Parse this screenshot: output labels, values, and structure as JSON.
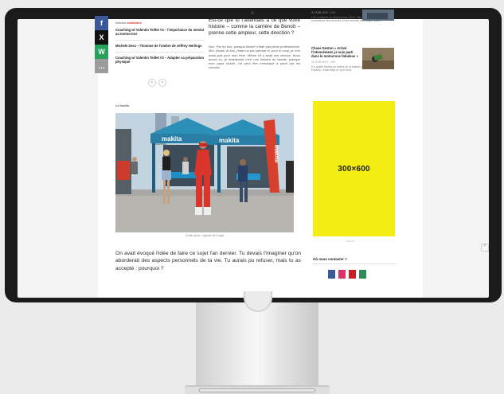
{
  "share": {
    "facebook": "f",
    "x": "X",
    "whatsapp": "W",
    "more": "…"
  },
  "related": {
    "heading_prefix": "Articles",
    "heading_accent": "similaires",
    "items": [
      "Coaching w/ Valentin Teillet #4 – l'importance du mental au motocross",
      "Michele Dera – l'homme de l'ombre de Jeffrey Herlings",
      "Coaching w/ Valentin Teillet #3 – Adapter sa préparation physique"
    ],
    "pager_prev": "‹",
    "pager_next": "›"
  },
  "article": {
    "intro_question": "Est-ce que tu t'attendais à ce que votre histoire – comme la carrière de Benoît – prenne cette ampleur, cette direction ?",
    "answer": "Non. Par du tout, puisque Benoît n'était pas pilote professionnel. Moi, j'avais 16 ans, j'étais un peu perdue et, pour le coup, je n'en avais pas pour mon frère. Même s'il y avait une chance. Nous avons su, je maintenais c'est une histoire de famille, puisque mon papa roulait. J'ai peut être embarqué à partir par les courses",
    "author_line": "La famille,",
    "photo_caption": "Crédits photo · légende de l'image",
    "body": "On avait évoqué l'idée de faire ce sujet l'an dernier. Tu devais t'imaginer qu'on aborderait des aspects personnels de ta vie. Tu aurais pu refuser, mais tu as accepté : pourquoi ?"
  },
  "photo": {
    "tent_brand_1": "makita",
    "tent_brand_2": "makita",
    "flag_brand": "makita"
  },
  "sidebar": {
    "top_date": "22 JUIN 2024 · 17H",
    "top_desc": "Les coulisses du Supercross 2024, San Diego, les sensations découvertes et les secrets de chaque pilote",
    "item2_title": "Chase Sexton « Arrivé l'intensément, je suis parti dans le motocross fabuleux »",
    "item2_date": "22 JUIN 2024 · 16H",
    "item2_desc": "Il a quitté Honda au début de la saison pour rejoindre l'équipe Factory. Il sait déjà ce qu'il veut.",
    "ad_label": "300×600",
    "ad_small": "Publicité",
    "contact_title": "Où nous contacter ?"
  },
  "ui": {
    "scroll_top": "^"
  }
}
